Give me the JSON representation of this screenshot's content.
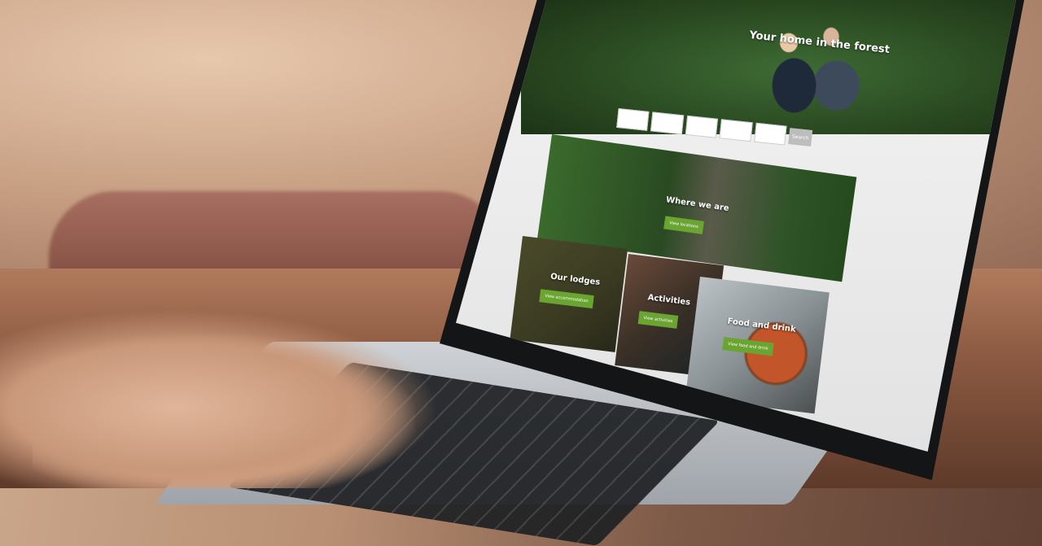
{
  "website": {
    "hero_title": "Your home in the forest",
    "search": {
      "fields": [
        "",
        "",
        "",
        "",
        ""
      ],
      "button_label": "Search"
    },
    "tiles": [
      {
        "title": "Where we are",
        "button": "View locations"
      },
      {
        "title": "Our lodges",
        "button": "View accommodation"
      },
      {
        "title": "Activities",
        "button": "View activities"
      },
      {
        "title": "Food and drink",
        "button": "View food and drink"
      }
    ]
  },
  "colors": {
    "accent_green": "#6aa532",
    "screen_bg": "#e6e6e6",
    "bezel": "#141517"
  }
}
